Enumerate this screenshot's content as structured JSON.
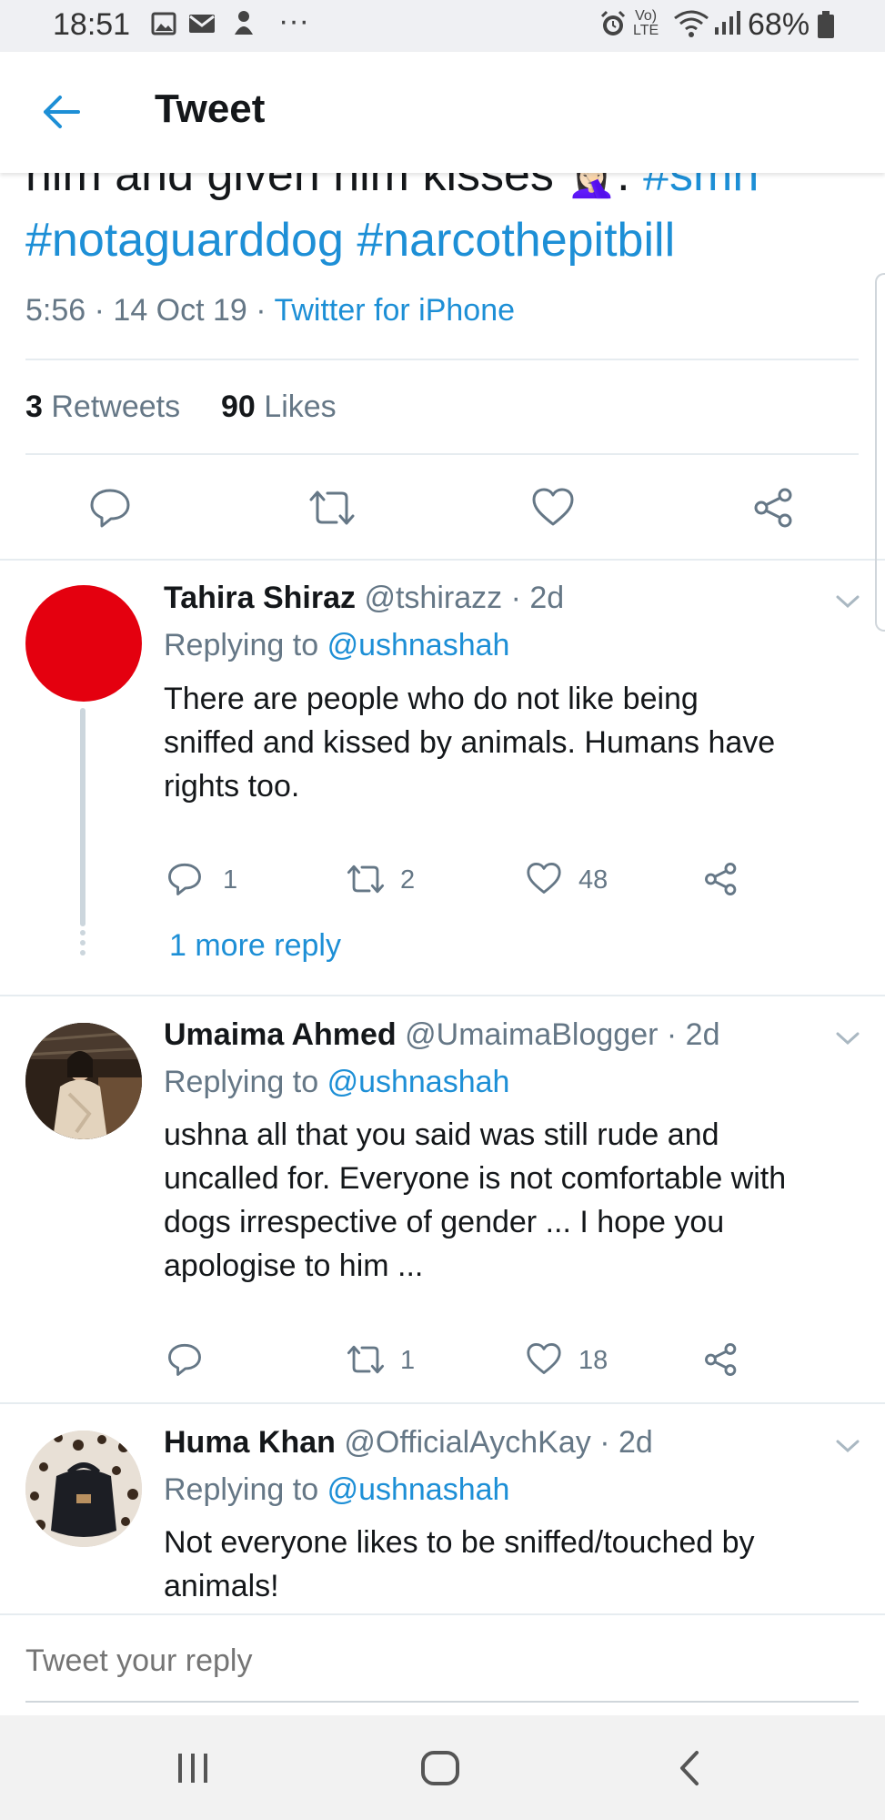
{
  "status_bar": {
    "time": "18:51",
    "battery": "68%",
    "network": "LTE",
    "volte": "Vo)"
  },
  "header": {
    "title": "Tweet",
    "back_icon": "arrow-left-icon"
  },
  "main_tweet": {
    "text_partial": "him and given him kisses",
    "hashtag_inline": "#smh",
    "emoji": "🤦🏻‍♀️",
    "hashtags": [
      "#notaguarddog",
      "#narcothepitbill"
    ],
    "time": "5:56",
    "date": "14 Oct 19",
    "sep": "·",
    "source": "Twitter for iPhone",
    "retweets_count": "3",
    "retweets_label": "Retweets",
    "likes_count": "90",
    "likes_label": "Likes"
  },
  "replies": [
    {
      "name": "Tahira Shiraz",
      "handle": "@tshirazz",
      "age": "· 2d",
      "replying_label": "Replying to",
      "replying_to": "@ushnashah",
      "lines": [
        "There are people who do not like being",
        "sniffed and kissed by animals. Humans have",
        "rights too."
      ],
      "reply_count": "1",
      "retweet_count": "2",
      "like_count": "48",
      "more_replies": "1 more reply",
      "avatar_color": "#e4000f"
    },
    {
      "name": "Umaima Ahmed",
      "handle": "@UmaimaBlogger",
      "age": "· 2d",
      "replying_label": "Replying to",
      "replying_to": "@ushnashah",
      "lines": [
        "ushna all that you said was still rude and",
        "uncalled for. Everyone is not comfortable with",
        "dogs irrespective of gender ... I hope you",
        "apologise to him ..."
      ],
      "reply_count": "",
      "retweet_count": "1",
      "like_count": "18"
    },
    {
      "name": "Huma Khan",
      "handle": "@OfficialAychKay",
      "age": "· 2d",
      "replying_label": "Replying to",
      "replying_to": "@ushnashah",
      "lines": [
        "Not everyone likes to be sniffed/touched by",
        "animals!"
      ]
    }
  ],
  "compose": {
    "placeholder": "Tweet your reply"
  },
  "colors": {
    "accent": "#1d8fd6",
    "text": "#14171a",
    "secondary": "#657786",
    "divider": "#e6ecf0"
  }
}
